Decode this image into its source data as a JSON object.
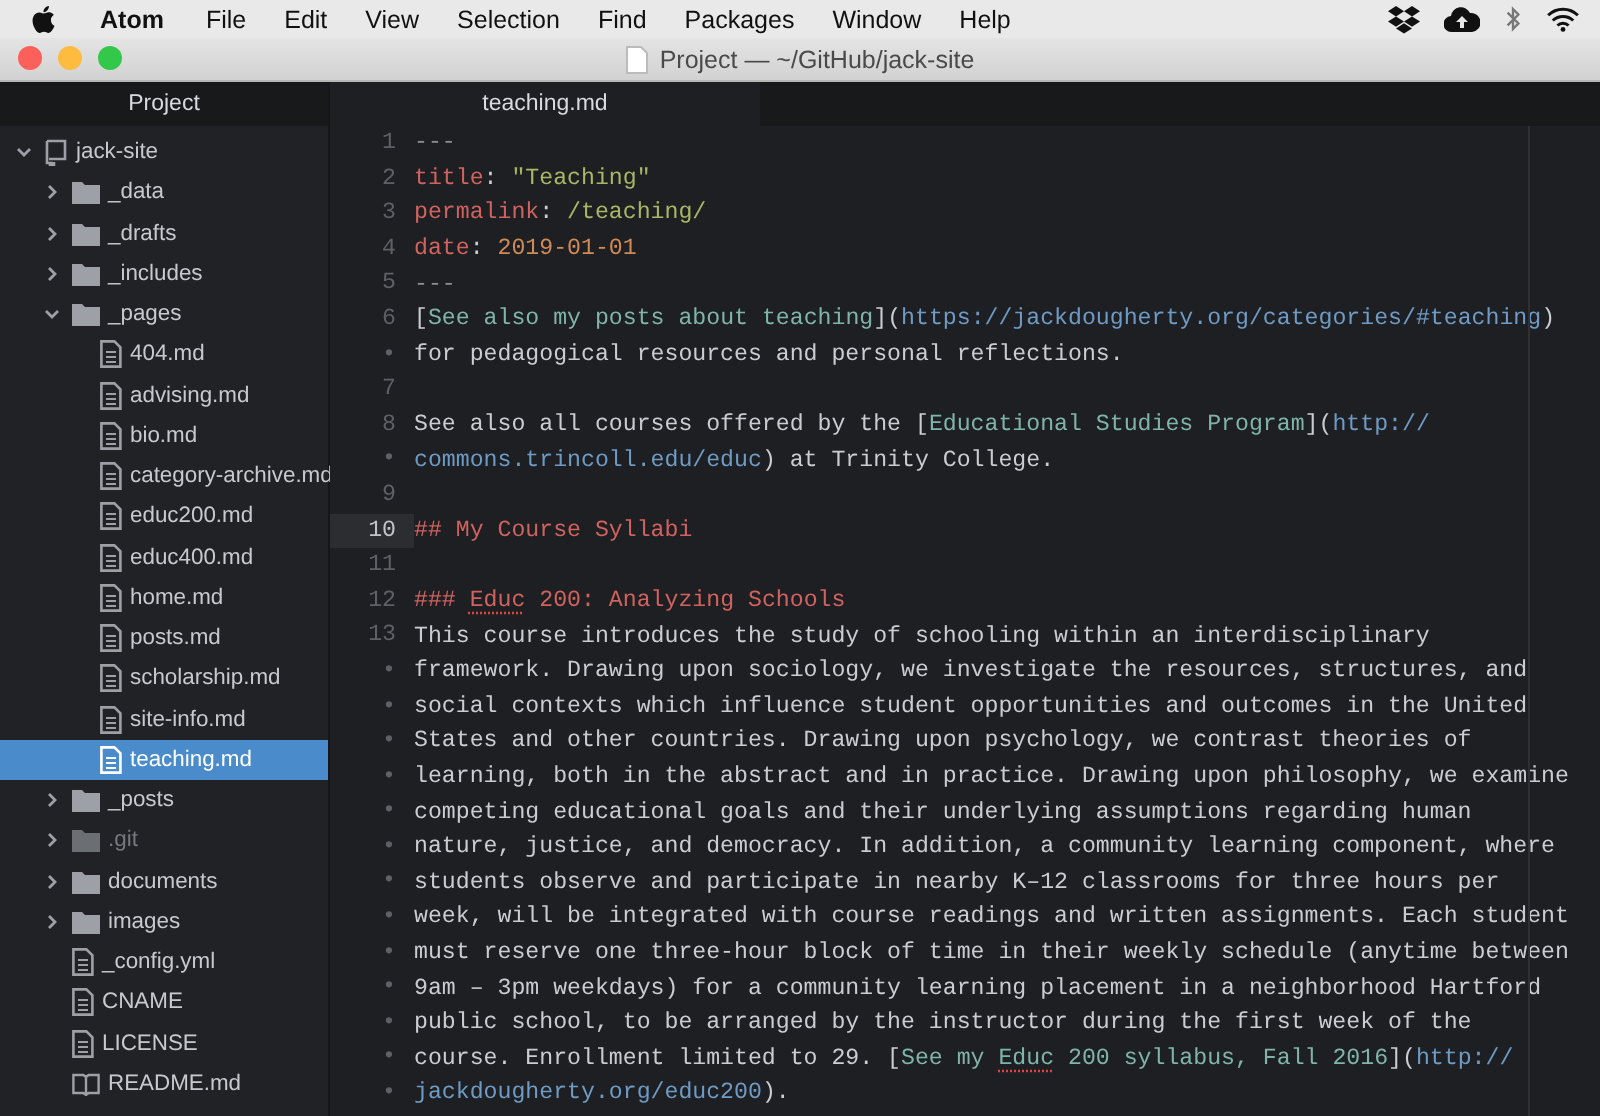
{
  "menu_bar": {
    "app_name": "Atom",
    "menus": [
      "File",
      "Edit",
      "View",
      "Selection",
      "Find",
      "Packages",
      "Window",
      "Help"
    ]
  },
  "window": {
    "title": "Project — ~/GitHub/jack-site"
  },
  "sidebar": {
    "title": "Project",
    "tree": [
      {
        "label": "jack-site",
        "kind": "repo",
        "expanded": true,
        "selected": false,
        "ignored": false,
        "children": [
          {
            "label": "_data",
            "kind": "folder",
            "expanded": false,
            "selected": false,
            "ignored": false
          },
          {
            "label": "_drafts",
            "kind": "folder",
            "expanded": false,
            "selected": false,
            "ignored": false
          },
          {
            "label": "_includes",
            "kind": "folder",
            "expanded": false,
            "selected": false,
            "ignored": false
          },
          {
            "label": "_pages",
            "kind": "folder",
            "expanded": true,
            "selected": false,
            "ignored": false,
            "children": [
              {
                "label": "404.md",
                "kind": "file",
                "selected": false,
                "ignored": false
              },
              {
                "label": "advising.md",
                "kind": "file",
                "selected": false,
                "ignored": false
              },
              {
                "label": "bio.md",
                "kind": "file",
                "selected": false,
                "ignored": false
              },
              {
                "label": "category-archive.md",
                "kind": "file",
                "selected": false,
                "ignored": false
              },
              {
                "label": "educ200.md",
                "kind": "file",
                "selected": false,
                "ignored": false
              },
              {
                "label": "educ400.md",
                "kind": "file",
                "selected": false,
                "ignored": false
              },
              {
                "label": "home.md",
                "kind": "file",
                "selected": false,
                "ignored": false
              },
              {
                "label": "posts.md",
                "kind": "file",
                "selected": false,
                "ignored": false
              },
              {
                "label": "scholarship.md",
                "kind": "file",
                "selected": false,
                "ignored": false
              },
              {
                "label": "site-info.md",
                "kind": "file",
                "selected": false,
                "ignored": false
              },
              {
                "label": "teaching.md",
                "kind": "file",
                "selected": true,
                "ignored": false
              }
            ]
          },
          {
            "label": "_posts",
            "kind": "folder",
            "expanded": false,
            "selected": false,
            "ignored": false
          },
          {
            "label": ".git",
            "kind": "folder",
            "expanded": false,
            "selected": false,
            "ignored": true
          },
          {
            "label": "documents",
            "kind": "folder",
            "expanded": false,
            "selected": false,
            "ignored": false
          },
          {
            "label": "images",
            "kind": "folder",
            "expanded": false,
            "selected": false,
            "ignored": false
          },
          {
            "label": "_config.yml",
            "kind": "file",
            "selected": false,
            "ignored": false
          },
          {
            "label": "CNAME",
            "kind": "file",
            "selected": false,
            "ignored": false
          },
          {
            "label": "LICENSE",
            "kind": "file",
            "selected": false,
            "ignored": false
          },
          {
            "label": "README.md",
            "kind": "book",
            "selected": false,
            "ignored": false
          }
        ]
      }
    ]
  },
  "tabs": [
    {
      "label": "teaching.md",
      "selected": true
    }
  ],
  "editor": {
    "lines": [
      {
        "number": "1",
        "selected": false,
        "segments": [
          {
            "kind": "punct",
            "text": "---",
            "misspelled": false
          }
        ]
      },
      {
        "number": "2",
        "selected": false,
        "segments": [
          {
            "kind": "key",
            "text": "title",
            "misspelled": false
          },
          {
            "kind": "text",
            "text": ": ",
            "misspelled": false
          },
          {
            "kind": "string",
            "text": "\"Teaching\"",
            "misspelled": false
          }
        ]
      },
      {
        "number": "3",
        "selected": false,
        "segments": [
          {
            "kind": "key",
            "text": "permalink",
            "misspelled": false
          },
          {
            "kind": "text",
            "text": ": ",
            "misspelled": false
          },
          {
            "kind": "string",
            "text": "/teaching/",
            "misspelled": false
          }
        ]
      },
      {
        "number": "4",
        "selected": false,
        "segments": [
          {
            "kind": "key",
            "text": "date",
            "misspelled": false
          },
          {
            "kind": "text",
            "text": ": ",
            "misspelled": false
          },
          {
            "kind": "number",
            "text": "2019-01-01",
            "misspelled": false
          }
        ]
      },
      {
        "number": "5",
        "selected": false,
        "segments": [
          {
            "kind": "punct",
            "text": "---",
            "misspelled": false
          }
        ]
      },
      {
        "number": "6",
        "selected": false,
        "segments": [
          {
            "kind": "text",
            "text": "[",
            "misspelled": false
          },
          {
            "kind": "link",
            "text": "See also my posts about teaching",
            "misspelled": false
          },
          {
            "kind": "text",
            "text": "](",
            "misspelled": false
          },
          {
            "kind": "url",
            "text": "https://jackdougherty.org/categories/#teaching",
            "misspelled": false
          },
          {
            "kind": "text",
            "text": ")",
            "misspelled": false
          }
        ]
      },
      {
        "number": "•",
        "selected": false,
        "segments": [
          {
            "kind": "text",
            "text": "for pedagogical resources and personal reflections.",
            "misspelled": false
          }
        ]
      },
      {
        "number": "7",
        "selected": false
      },
      {
        "number": "8",
        "selected": false,
        "segments": [
          {
            "kind": "text",
            "text": "See also all courses offered by the [",
            "misspelled": false
          },
          {
            "kind": "link",
            "text": "Educational Studies Program",
            "misspelled": false
          },
          {
            "kind": "text",
            "text": "](",
            "misspelled": false
          },
          {
            "kind": "url",
            "text": "http://",
            "misspelled": false
          }
        ]
      },
      {
        "number": "•",
        "selected": false,
        "segments": [
          {
            "kind": "url",
            "text": "commons.trincoll.edu/educ",
            "misspelled": false
          },
          {
            "kind": "text",
            "text": ") at Trinity College.",
            "misspelled": false
          }
        ]
      },
      {
        "number": "9",
        "selected": false
      },
      {
        "number": "10",
        "selected": true,
        "segments": [
          {
            "kind": "heading",
            "text": "## My Course Syllabi",
            "misspelled": false
          }
        ]
      },
      {
        "number": "11",
        "selected": false
      },
      {
        "number": "12",
        "selected": false,
        "segments": [
          {
            "kind": "heading",
            "text": "### ",
            "misspelled": false
          },
          {
            "kind": "heading",
            "text": "Educ",
            "misspelled": true
          },
          {
            "kind": "heading",
            "text": " 200: Analyzing Schools",
            "misspelled": false
          }
        ]
      },
      {
        "number": "13",
        "selected": false,
        "segments": [
          {
            "kind": "text",
            "text": "This course introduces the study of schooling within an interdisciplinary",
            "misspelled": false
          }
        ]
      },
      {
        "number": "•",
        "selected": false,
        "segments": [
          {
            "kind": "text",
            "text": "framework. Drawing upon sociology, we investigate the resources, structures, and",
            "misspelled": false
          }
        ]
      },
      {
        "number": "•",
        "selected": false,
        "segments": [
          {
            "kind": "text",
            "text": "social contexts which influence student opportunities and outcomes in the United",
            "misspelled": false
          }
        ]
      },
      {
        "number": "•",
        "selected": false,
        "segments": [
          {
            "kind": "text",
            "text": "States and other countries. Drawing upon psychology, we contrast theories of",
            "misspelled": false
          }
        ]
      },
      {
        "number": "•",
        "selected": false,
        "segments": [
          {
            "kind": "text",
            "text": "learning, both in the abstract and in practice. Drawing upon philosophy, we examine",
            "misspelled": false
          }
        ]
      },
      {
        "number": "•",
        "selected": false,
        "segments": [
          {
            "kind": "text",
            "text": "competing educational goals and their underlying assumptions regarding human",
            "misspelled": false
          }
        ]
      },
      {
        "number": "•",
        "selected": false,
        "segments": [
          {
            "kind": "text",
            "text": "nature, justice, and democracy. In addition, a community learning component, where",
            "misspelled": false
          }
        ]
      },
      {
        "number": "•",
        "selected": false,
        "segments": [
          {
            "kind": "text",
            "text": "students observe and participate in nearby K–12 classrooms for three hours per",
            "misspelled": false
          }
        ]
      },
      {
        "number": "•",
        "selected": false,
        "segments": [
          {
            "kind": "text",
            "text": "week, will be integrated with course readings and written assignments. Each student",
            "misspelled": false
          }
        ]
      },
      {
        "number": "•",
        "selected": false,
        "segments": [
          {
            "kind": "text",
            "text": "must reserve one three-hour block of time in their weekly schedule (anytime between",
            "misspelled": false
          }
        ]
      },
      {
        "number": "•",
        "selected": false,
        "segments": [
          {
            "kind": "text",
            "text": "9am – 3pm weekdays) for a community learning placement in a neighborhood Hartford",
            "misspelled": false
          }
        ]
      },
      {
        "number": "•",
        "selected": false,
        "segments": [
          {
            "kind": "text",
            "text": "public school, to be arranged by the instructor during the first week of the",
            "misspelled": false
          }
        ]
      },
      {
        "number": "•",
        "selected": false,
        "segments": [
          {
            "kind": "text",
            "text": "course. Enrollment limited to 29. [",
            "misspelled": false
          },
          {
            "kind": "link",
            "text": "See my ",
            "misspelled": false
          },
          {
            "kind": "link",
            "text": "Educ",
            "misspelled": true
          },
          {
            "kind": "link",
            "text": " 200 syllabus, Fall 2016",
            "misspelled": false
          },
          {
            "kind": "text",
            "text": "](",
            "misspelled": false
          },
          {
            "kind": "url",
            "text": "http://",
            "misspelled": false
          }
        ]
      },
      {
        "number": "•",
        "selected": false,
        "segments": [
          {
            "kind": "url",
            "text": "jackdougherty.org/educ200",
            "misspelled": false
          },
          {
            "kind": "text",
            "text": ").",
            "misspelled": false
          }
        ]
      }
    ]
  }
}
